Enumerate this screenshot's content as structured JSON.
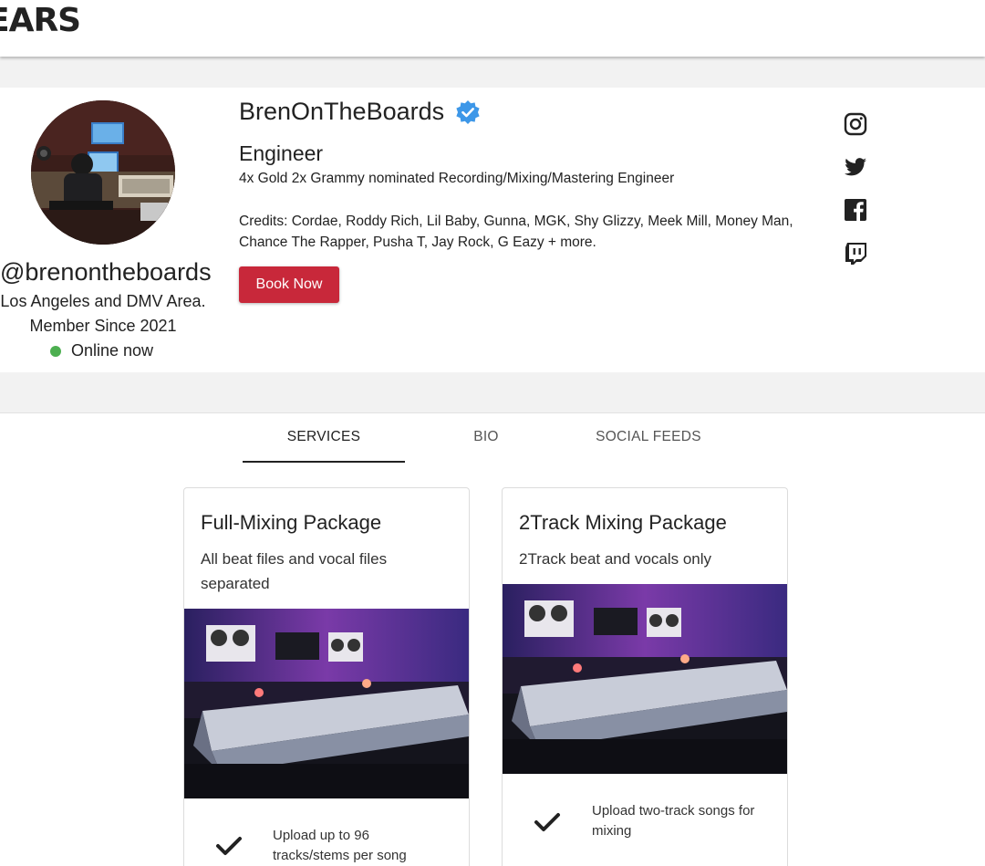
{
  "header": {
    "logo_text": "EARS"
  },
  "profile": {
    "name": "BrenOnTheBoards",
    "verified_icon": "verified-badge-icon",
    "role": "Engineer",
    "tagline": "4x Gold 2x Grammy nominated Recording/Mixing/Mastering Engineer",
    "credits": "Credits: Cordae, Roddy Rich, Lil Baby, Gunna, MGK, Shy Glizzy, Meek Mill, Money Man, Chance The Rapper, Pusha T, Jay Rock, G Eazy + more.",
    "book_label": "Book Now",
    "handle": "@brenontheboards",
    "location": "Los Angeles and DMV Area.",
    "member_since": "Member Since 2021",
    "status": "Online now",
    "status_color": "#4caf50",
    "accent_color": "#c8283a"
  },
  "social": [
    "instagram-icon",
    "twitter-icon",
    "facebook-icon",
    "twitch-icon"
  ],
  "tabs": [
    {
      "label": "SERVICES",
      "active": true
    },
    {
      "label": "BIO",
      "active": false
    },
    {
      "label": "SOCIAL FEEDS",
      "active": false
    }
  ],
  "services": [
    {
      "title": "Full-Mixing Package",
      "description": "All beat files and vocal files separated",
      "feature": "Upload up to 96 tracks/stems per song"
    },
    {
      "title": "2Track Mixing Package",
      "description": "2Track beat and vocals only",
      "feature": "Upload two-track songs for mixing"
    }
  ]
}
